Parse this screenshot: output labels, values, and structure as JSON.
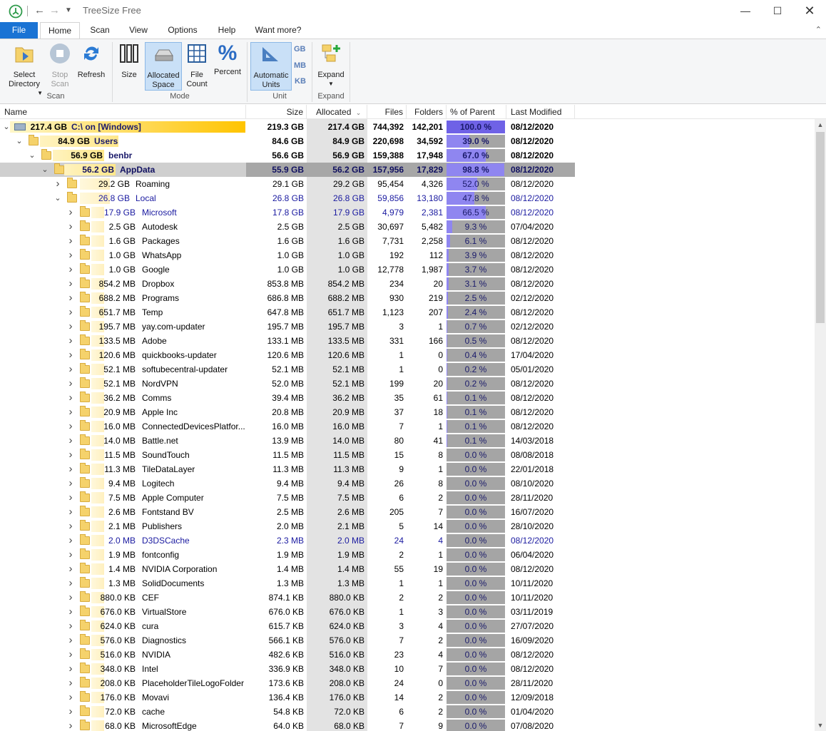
{
  "app": {
    "title": "TreeSize Free"
  },
  "tabs": [
    "File",
    "Home",
    "Scan",
    "View",
    "Options",
    "Help",
    "Want more?"
  ],
  "ribbon": {
    "select_directory": "Select Directory",
    "stop_scan": "Stop Scan",
    "refresh": "Refresh",
    "group_scan": "Scan",
    "size": "Size",
    "allocated_space": "Allocated Space",
    "file_count": "File Count",
    "percent": "Percent",
    "group_mode": "Mode",
    "automatic_units": "Automatic Units",
    "unit_gb": "GB",
    "unit_mb": "MB",
    "unit_kb": "KB",
    "group_unit": "Unit",
    "expand": "Expand",
    "group_expand": "Expand"
  },
  "columns": {
    "name": "Name",
    "size": "Size",
    "allocated": "Allocated",
    "files": "Files",
    "folders": "Folders",
    "percent_parent": "% of Parent ...",
    "last_modified": "Last Modified"
  },
  "rows": [
    {
      "level": 0,
      "exp": "v",
      "alloc_label": "217.4 GB",
      "name": "C:\\  on  [Windows]",
      "size": "219.3 GB",
      "allocated": "217.4 GB",
      "files": "744,392",
      "folders": "142,201",
      "pct": "100.0 %",
      "pct_value": 100.0,
      "modified": "08/12/2020",
      "bold": true
    },
    {
      "level": 1,
      "exp": "v",
      "alloc_label": "84.9 GB",
      "name": "Users",
      "size": "84.6 GB",
      "allocated": "84.9 GB",
      "files": "220,698",
      "folders": "34,592",
      "pct": "39.0 %",
      "pct_value": 39.0,
      "modified": "08/12/2020",
      "bold": true
    },
    {
      "level": 2,
      "exp": "v",
      "alloc_label": "56.9 GB",
      "name": "benbr",
      "size": "56.6 GB",
      "allocated": "56.9 GB",
      "files": "159,388",
      "folders": "17,948",
      "pct": "67.0 %",
      "pct_value": 67.0,
      "modified": "08/12/2020",
      "bold": true
    },
    {
      "level": 3,
      "exp": "v",
      "alloc_label": "56.2 GB",
      "name": "AppData",
      "size": "55.9 GB",
      "allocated": "56.2 GB",
      "files": "157,956",
      "folders": "17,829",
      "pct": "98.8 %",
      "pct_value": 98.8,
      "modified": "08/12/2020",
      "bold": true,
      "selected": true
    },
    {
      "level": 4,
      "exp": ">",
      "alloc_label": "29.2 GB",
      "name": "Roaming",
      "size": "29.1 GB",
      "allocated": "29.2 GB",
      "files": "95,454",
      "folders": "4,326",
      "pct": "52.0 %",
      "pct_value": 52.0,
      "modified": "08/12/2020"
    },
    {
      "level": 4,
      "exp": "v",
      "alloc_label": "26.8 GB",
      "name": "Local",
      "size": "26.8 GB",
      "allocated": "26.8 GB",
      "files": "59,856",
      "folders": "13,180",
      "pct": "47.8 %",
      "pct_value": 47.8,
      "modified": "08/12/2020",
      "blue": true
    },
    {
      "level": 5,
      "exp": ">",
      "alloc_label": "17.9 GB",
      "name": "Microsoft",
      "size": "17.8 GB",
      "allocated": "17.9 GB",
      "files": "4,979",
      "folders": "2,381",
      "pct": "66.5 %",
      "pct_value": 66.5,
      "modified": "08/12/2020",
      "blue": true
    },
    {
      "level": 5,
      "exp": ">",
      "alloc_label": "2.5 GB",
      "name": "Autodesk",
      "size": "2.5 GB",
      "allocated": "2.5 GB",
      "files": "30,697",
      "folders": "5,482",
      "pct": "9.3 %",
      "pct_value": 9.3,
      "modified": "07/04/2020"
    },
    {
      "level": 5,
      "exp": ">",
      "alloc_label": "1.6 GB",
      "name": "Packages",
      "size": "1.6 GB",
      "allocated": "1.6 GB",
      "files": "7,731",
      "folders": "2,258",
      "pct": "6.1 %",
      "pct_value": 6.1,
      "modified": "08/12/2020"
    },
    {
      "level": 5,
      "exp": ">",
      "alloc_label": "1.0 GB",
      "name": "WhatsApp",
      "size": "1.0 GB",
      "allocated": "1.0 GB",
      "files": "192",
      "folders": "112",
      "pct": "3.9 %",
      "pct_value": 3.9,
      "modified": "08/12/2020"
    },
    {
      "level": 5,
      "exp": ">",
      "alloc_label": "1.0 GB",
      "name": "Google",
      "size": "1.0 GB",
      "allocated": "1.0 GB",
      "files": "12,778",
      "folders": "1,987",
      "pct": "3.7 %",
      "pct_value": 3.7,
      "modified": "08/12/2020"
    },
    {
      "level": 5,
      "exp": ">",
      "alloc_label": "854.2 MB",
      "name": "Dropbox",
      "size": "853.8 MB",
      "allocated": "854.2 MB",
      "files": "234",
      "folders": "20",
      "pct": "3.1 %",
      "pct_value": 3.1,
      "modified": "08/12/2020"
    },
    {
      "level": 5,
      "exp": ">",
      "alloc_label": "688.2 MB",
      "name": "Programs",
      "size": "686.8 MB",
      "allocated": "688.2 MB",
      "files": "930",
      "folders": "219",
      "pct": "2.5 %",
      "pct_value": 2.5,
      "modified": "02/12/2020"
    },
    {
      "level": 5,
      "exp": ">",
      "alloc_label": "651.7 MB",
      "name": "Temp",
      "size": "647.8 MB",
      "allocated": "651.7 MB",
      "files": "1,123",
      "folders": "207",
      "pct": "2.4 %",
      "pct_value": 2.4,
      "modified": "08/12/2020"
    },
    {
      "level": 5,
      "exp": ">",
      "alloc_label": "195.7 MB",
      "name": "yay.com-updater",
      "size": "195.7 MB",
      "allocated": "195.7 MB",
      "files": "3",
      "folders": "1",
      "pct": "0.7 %",
      "pct_value": 0.7,
      "modified": "02/12/2020"
    },
    {
      "level": 5,
      "exp": ">",
      "alloc_label": "133.5 MB",
      "name": "Adobe",
      "size": "133.1 MB",
      "allocated": "133.5 MB",
      "files": "331",
      "folders": "166",
      "pct": "0.5 %",
      "pct_value": 0.5,
      "modified": "08/12/2020"
    },
    {
      "level": 5,
      "exp": ">",
      "alloc_label": "120.6 MB",
      "name": "quickbooks-updater",
      "size": "120.6 MB",
      "allocated": "120.6 MB",
      "files": "1",
      "folders": "0",
      "pct": "0.4 %",
      "pct_value": 0.4,
      "modified": "17/04/2020"
    },
    {
      "level": 5,
      "exp": ">",
      "alloc_label": "52.1 MB",
      "name": "softubecentral-updater",
      "size": "52.1 MB",
      "allocated": "52.1 MB",
      "files": "1",
      "folders": "0",
      "pct": "0.2 %",
      "pct_value": 0.2,
      "modified": "05/01/2020"
    },
    {
      "level": 5,
      "exp": ">",
      "alloc_label": "52.1 MB",
      "name": "NordVPN",
      "size": "52.0 MB",
      "allocated": "52.1 MB",
      "files": "199",
      "folders": "20",
      "pct": "0.2 %",
      "pct_value": 0.2,
      "modified": "08/12/2020"
    },
    {
      "level": 5,
      "exp": ">",
      "alloc_label": "36.2 MB",
      "name": "Comms",
      "size": "39.4 MB",
      "allocated": "36.2 MB",
      "files": "35",
      "folders": "61",
      "pct": "0.1 %",
      "pct_value": 0.1,
      "modified": "08/12/2020"
    },
    {
      "level": 5,
      "exp": ">",
      "alloc_label": "20.9 MB",
      "name": "Apple Inc",
      "size": "20.8 MB",
      "allocated": "20.9 MB",
      "files": "37",
      "folders": "18",
      "pct": "0.1 %",
      "pct_value": 0.1,
      "modified": "08/12/2020"
    },
    {
      "level": 5,
      "exp": ">",
      "alloc_label": "16.0 MB",
      "name": "ConnectedDevicesPlatfor...",
      "size": "16.0 MB",
      "allocated": "16.0 MB",
      "files": "7",
      "folders": "1",
      "pct": "0.1 %",
      "pct_value": 0.1,
      "modified": "08/12/2020"
    },
    {
      "level": 5,
      "exp": ">",
      "alloc_label": "14.0 MB",
      "name": "Battle.net",
      "size": "13.9 MB",
      "allocated": "14.0 MB",
      "files": "80",
      "folders": "41",
      "pct": "0.1 %",
      "pct_value": 0.1,
      "modified": "14/03/2018"
    },
    {
      "level": 5,
      "exp": ">",
      "alloc_label": "11.5 MB",
      "name": "SoundTouch",
      "size": "11.5 MB",
      "allocated": "11.5 MB",
      "files": "15",
      "folders": "8",
      "pct": "0.0 %",
      "pct_value": 0.0,
      "modified": "08/08/2018"
    },
    {
      "level": 5,
      "exp": ">",
      "alloc_label": "11.3 MB",
      "name": "TileDataLayer",
      "size": "11.3 MB",
      "allocated": "11.3 MB",
      "files": "9",
      "folders": "1",
      "pct": "0.0 %",
      "pct_value": 0.0,
      "modified": "22/01/2018"
    },
    {
      "level": 5,
      "exp": ">",
      "alloc_label": "9.4 MB",
      "name": "Logitech",
      "size": "9.4 MB",
      "allocated": "9.4 MB",
      "files": "26",
      "folders": "8",
      "pct": "0.0 %",
      "pct_value": 0.0,
      "modified": "08/10/2020"
    },
    {
      "level": 5,
      "exp": ">",
      "alloc_label": "7.5 MB",
      "name": "Apple Computer",
      "size": "7.5 MB",
      "allocated": "7.5 MB",
      "files": "6",
      "folders": "2",
      "pct": "0.0 %",
      "pct_value": 0.0,
      "modified": "28/11/2020"
    },
    {
      "level": 5,
      "exp": ">",
      "alloc_label": "2.6 MB",
      "name": "Fontstand BV",
      "size": "2.5 MB",
      "allocated": "2.6 MB",
      "files": "205",
      "folders": "7",
      "pct": "0.0 %",
      "pct_value": 0.0,
      "modified": "16/07/2020"
    },
    {
      "level": 5,
      "exp": ">",
      "alloc_label": "2.1 MB",
      "name": "Publishers",
      "size": "2.0 MB",
      "allocated": "2.1 MB",
      "files": "5",
      "folders": "14",
      "pct": "0.0 %",
      "pct_value": 0.0,
      "modified": "28/10/2020"
    },
    {
      "level": 5,
      "exp": ">",
      "alloc_label": "2.0 MB",
      "name": "D3DSCache",
      "size": "2.3 MB",
      "allocated": "2.0 MB",
      "files": "24",
      "folders": "4",
      "pct": "0.0 %",
      "pct_value": 0.0,
      "modified": "08/12/2020",
      "blue": true
    },
    {
      "level": 5,
      "exp": ">",
      "alloc_label": "1.9 MB",
      "name": "fontconfig",
      "size": "1.9 MB",
      "allocated": "1.9 MB",
      "files": "2",
      "folders": "1",
      "pct": "0.0 %",
      "pct_value": 0.0,
      "modified": "06/04/2020"
    },
    {
      "level": 5,
      "exp": ">",
      "alloc_label": "1.4 MB",
      "name": "NVIDIA Corporation",
      "size": "1.4 MB",
      "allocated": "1.4 MB",
      "files": "55",
      "folders": "19",
      "pct": "0.0 %",
      "pct_value": 0.0,
      "modified": "08/12/2020"
    },
    {
      "level": 5,
      "exp": ">",
      "alloc_label": "1.3 MB",
      "name": "SolidDocuments",
      "size": "1.3 MB",
      "allocated": "1.3 MB",
      "files": "1",
      "folders": "1",
      "pct": "0.0 %",
      "pct_value": 0.0,
      "modified": "10/11/2020"
    },
    {
      "level": 5,
      "exp": ">",
      "alloc_label": "880.0 KB",
      "name": "CEF",
      "size": "874.1 KB",
      "allocated": "880.0 KB",
      "files": "2",
      "folders": "2",
      "pct": "0.0 %",
      "pct_value": 0.0,
      "modified": "10/11/2020"
    },
    {
      "level": 5,
      "exp": ">",
      "alloc_label": "676.0 KB",
      "name": "VirtualStore",
      "size": "676.0 KB",
      "allocated": "676.0 KB",
      "files": "1",
      "folders": "3",
      "pct": "0.0 %",
      "pct_value": 0.0,
      "modified": "03/11/2019"
    },
    {
      "level": 5,
      "exp": ">",
      "alloc_label": "624.0 KB",
      "name": "cura",
      "size": "615.7 KB",
      "allocated": "624.0 KB",
      "files": "3",
      "folders": "4",
      "pct": "0.0 %",
      "pct_value": 0.0,
      "modified": "27/07/2020"
    },
    {
      "level": 5,
      "exp": ">",
      "alloc_label": "576.0 KB",
      "name": "Diagnostics",
      "size": "566.1 KB",
      "allocated": "576.0 KB",
      "files": "7",
      "folders": "2",
      "pct": "0.0 %",
      "pct_value": 0.0,
      "modified": "16/09/2020"
    },
    {
      "level": 5,
      "exp": ">",
      "alloc_label": "516.0 KB",
      "name": "NVIDIA",
      "size": "482.6 KB",
      "allocated": "516.0 KB",
      "files": "23",
      "folders": "4",
      "pct": "0.0 %",
      "pct_value": 0.0,
      "modified": "08/12/2020"
    },
    {
      "level": 5,
      "exp": ">",
      "alloc_label": "348.0 KB",
      "name": "Intel",
      "size": "336.9 KB",
      "allocated": "348.0 KB",
      "files": "10",
      "folders": "7",
      "pct": "0.0 %",
      "pct_value": 0.0,
      "modified": "08/12/2020"
    },
    {
      "level": 5,
      "exp": ">",
      "alloc_label": "208.0 KB",
      "name": "PlaceholderTileLogoFolder",
      "size": "173.6 KB",
      "allocated": "208.0 KB",
      "files": "24",
      "folders": "0",
      "pct": "0.0 %",
      "pct_value": 0.0,
      "modified": "28/11/2020"
    },
    {
      "level": 5,
      "exp": ">",
      "alloc_label": "176.0 KB",
      "name": "Movavi",
      "size": "136.4 KB",
      "allocated": "176.0 KB",
      "files": "14",
      "folders": "2",
      "pct": "0.0 %",
      "pct_value": 0.0,
      "modified": "12/09/2018"
    },
    {
      "level": 5,
      "exp": ">",
      "alloc_label": "72.0 KB",
      "name": "cache",
      "size": "54.8 KB",
      "allocated": "72.0 KB",
      "files": "6",
      "folders": "2",
      "pct": "0.0 %",
      "pct_value": 0.0,
      "modified": "01/04/2020"
    },
    {
      "level": 5,
      "exp": ">",
      "alloc_label": "68.0 KB",
      "name": "MicrosoftEdge",
      "size": "64.0 KB",
      "allocated": "68.0 KB",
      "files": "7",
      "folders": "9",
      "pct": "0.0 %",
      "pct_value": 0.0,
      "modified": "07/08/2020"
    }
  ],
  "colors": {
    "file_tab": "#1a73d4",
    "pct_fill": "#8f86f0",
    "pct_bg": "#a5a5a5",
    "name_bar": "#ffd64a",
    "folder": "#f5d26b"
  }
}
